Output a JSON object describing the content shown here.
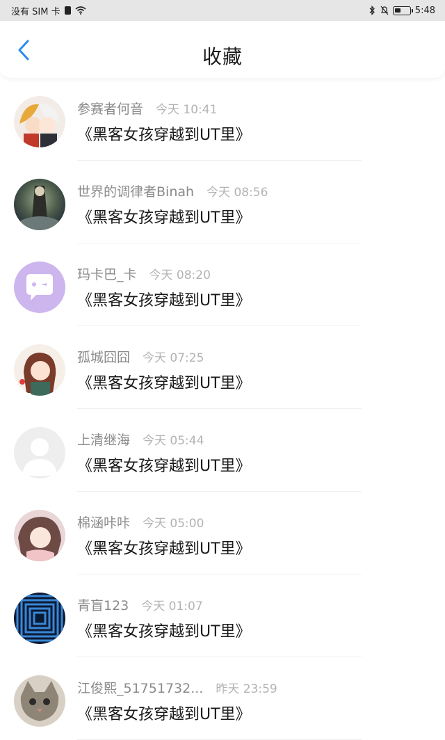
{
  "status_bar": {
    "carrier": "没有 SIM 卡",
    "time": "5:48"
  },
  "header": {
    "title": "收藏",
    "back_icon": "chevron-left-icon",
    "accent_color": "#2a8cf0"
  },
  "favorites": [
    {
      "user": "参赛者何音",
      "time": "今天 10:41",
      "title": "《黑客女孩穿越到UT里》"
    },
    {
      "user": "世界的调律者Binah",
      "time": "今天 08:56",
      "title": "《黑客女孩穿越到UT里》"
    },
    {
      "user": "玛卡巴_卡",
      "time": "今天 08:20",
      "title": "《黑客女孩穿越到UT里》"
    },
    {
      "user": "孤城囧囧",
      "time": "今天 07:25",
      "title": "《黑客女孩穿越到UT里》"
    },
    {
      "user": "上清继海",
      "time": "今天 05:44",
      "title": "《黑客女孩穿越到UT里》"
    },
    {
      "user": "棉涵咔咔",
      "time": "今天 05:00",
      "title": "《黑客女孩穿越到UT里》"
    },
    {
      "user": "青盲123",
      "time": "今天 01:07",
      "title": "《黑客女孩穿越到UT里》"
    },
    {
      "user": "江俊熙_51751732...",
      "time": "昨天 23:59",
      "title": "《黑客女孩穿越到UT里》"
    }
  ]
}
